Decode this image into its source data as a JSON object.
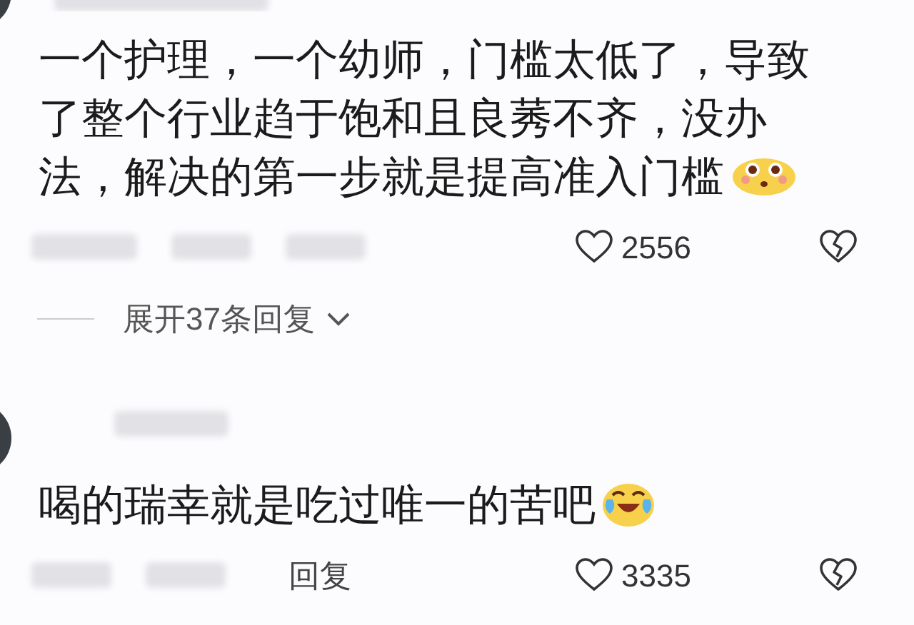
{
  "comments": [
    {
      "text": "一个护理，一个幼师，门槛太低了，导致了整个行业趋于饱和且良莠不齐，没办法，解决的第一步就是提高准入门槛",
      "emoji": {
        "kind": "pleading"
      },
      "likes": "2556",
      "replies_toggle": "展开37条回复"
    },
    {
      "text": "喝的瑞幸就是吃过唯一的苦吧",
      "emoji": {
        "kind": "laughing_tears"
      },
      "reply_button": "回复",
      "likes": "3335"
    }
  ]
}
